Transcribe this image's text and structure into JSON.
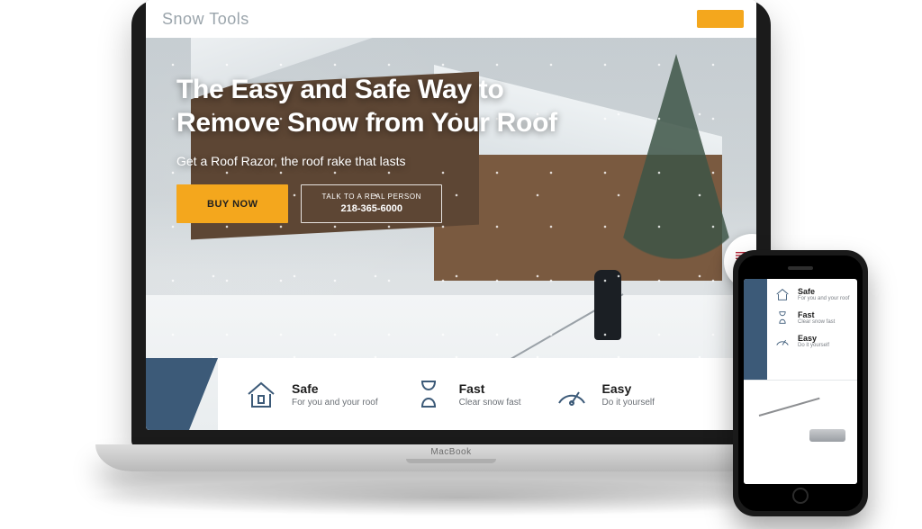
{
  "laptop": {
    "brand": "MacBook"
  },
  "header": {
    "logo": "Snow Tools",
    "cta_label": ""
  },
  "hero": {
    "title": "The Easy and Safe Way to Remove Snow from Your Roof",
    "subtitle": "Get a Roof Razor, the roof rake that lasts",
    "buy_label": "BUY NOW",
    "phone_line1": "TALK TO A REAL PERSON",
    "phone_line2": "218-365-6000"
  },
  "features": [
    {
      "icon": "house-shield-icon",
      "title": "Safe",
      "desc": "For you and your roof"
    },
    {
      "icon": "hourglass-icon",
      "title": "Fast",
      "desc": "Clear snow fast"
    },
    {
      "icon": "gauge-icon",
      "title": "Easy",
      "desc": "Do it yourself"
    }
  ],
  "phone_features": [
    {
      "icon": "house-shield-icon",
      "title": "Safe",
      "desc": "For you and your roof"
    },
    {
      "icon": "hourglass-icon",
      "title": "Fast",
      "desc": "Clear snow fast"
    },
    {
      "icon": "gauge-icon",
      "title": "Easy",
      "desc": "Do it yourself"
    }
  ],
  "colors": {
    "accent": "#f4a71d",
    "brand_blue": "#3c5a78"
  }
}
